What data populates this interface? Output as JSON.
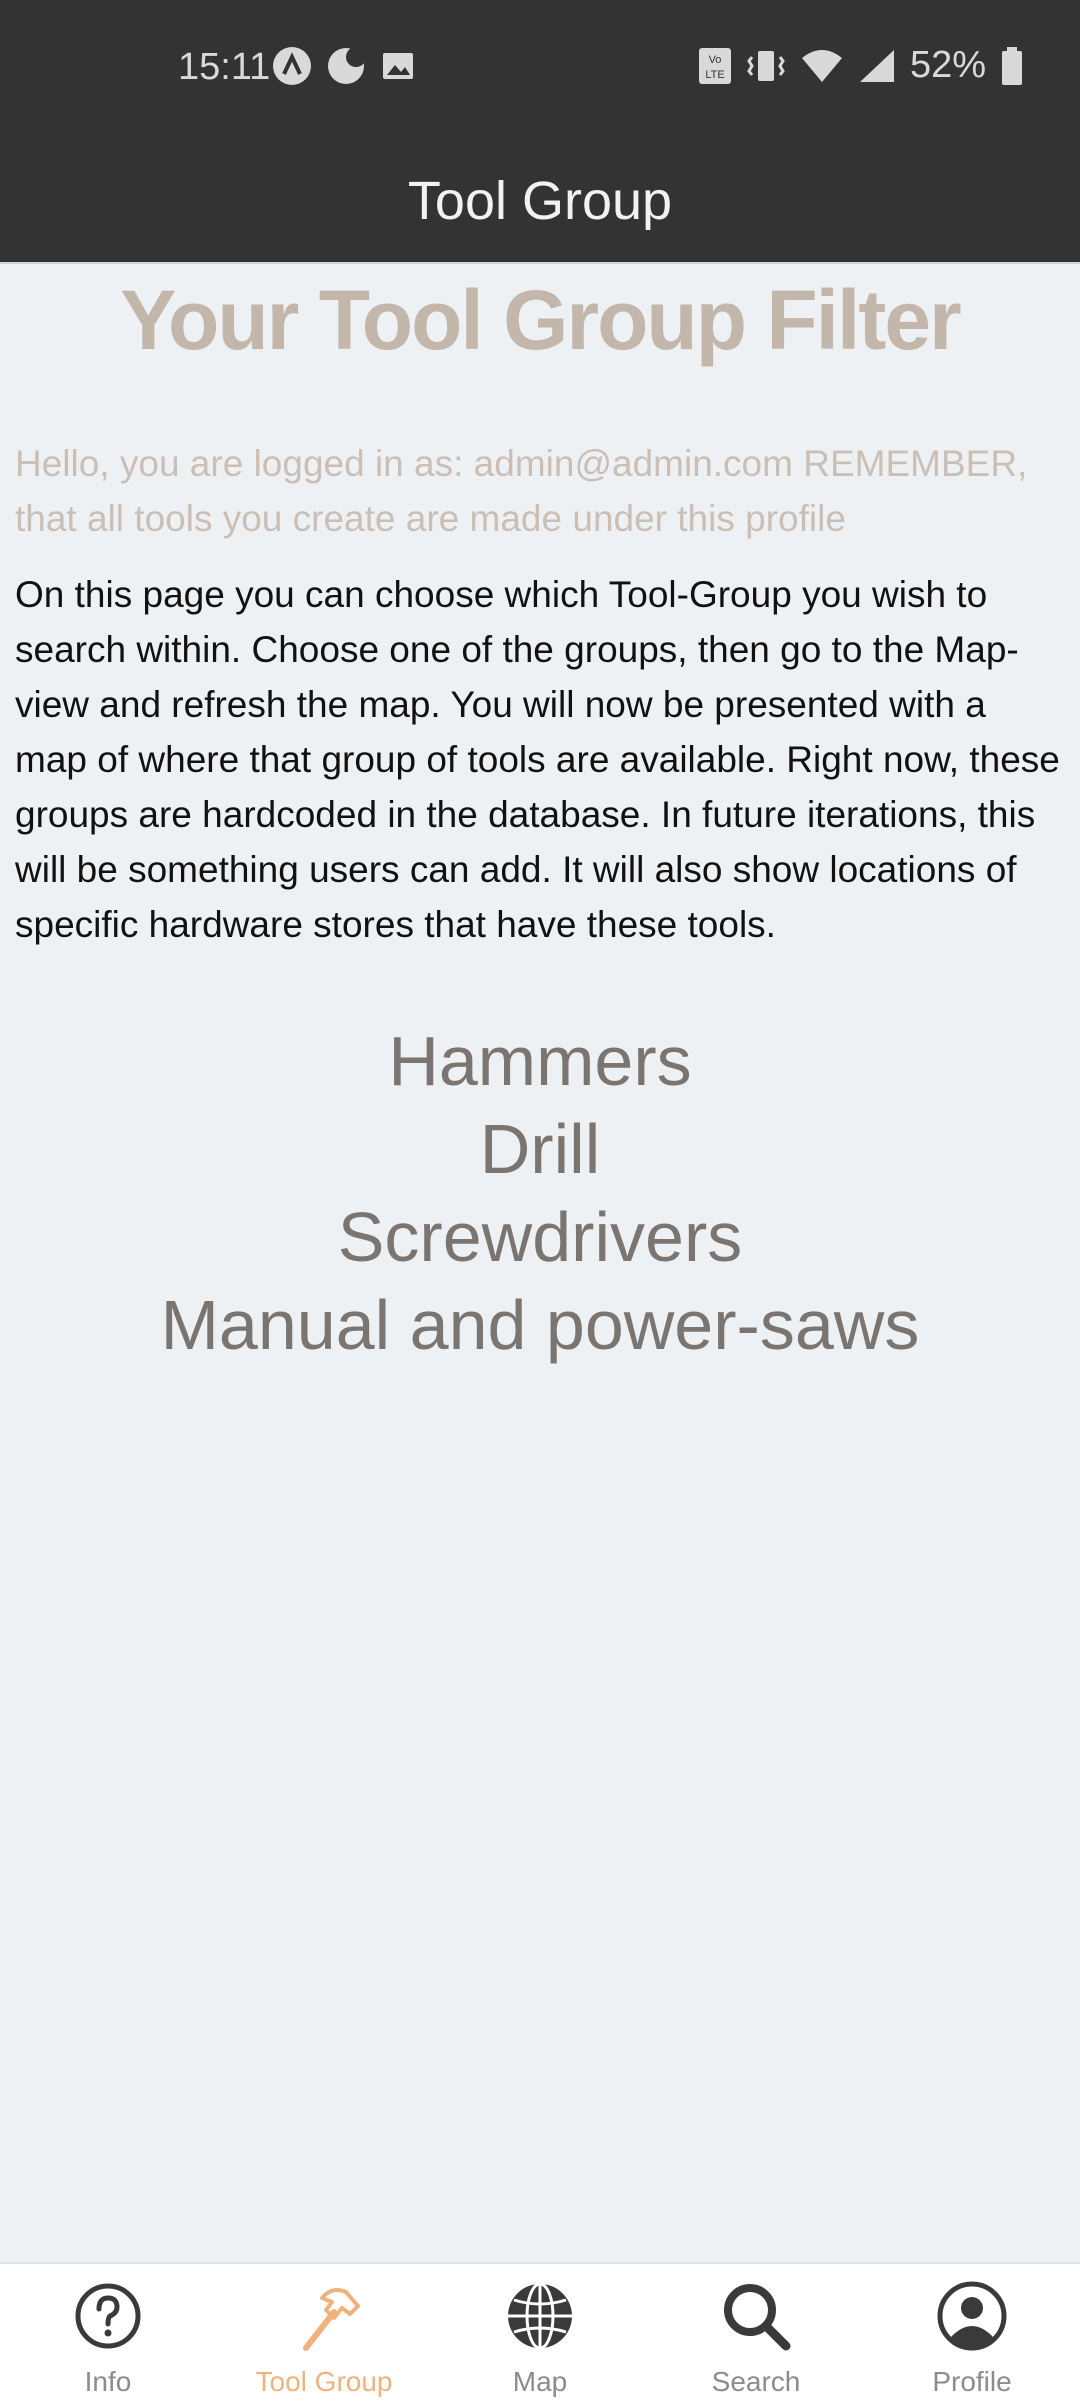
{
  "status_bar": {
    "time": "15:11",
    "battery": "52%",
    "icons": [
      "android-icon",
      "moon-icon",
      "image-icon",
      "volte-icon",
      "vibrate-icon",
      "wifi-icon",
      "signal-icon",
      "battery-icon"
    ]
  },
  "header": {
    "title": "Tool Group"
  },
  "main": {
    "title": "Your Tool Group Filter",
    "hello": "Hello, you are logged in as: admin@admin.com REMEMBER, that all tools you create are made under this profile",
    "description": "On this page you can choose which Tool-Group you wish to search within. Choose one of the groups, then go to the Map-view and refresh the map. You will now be presented with a map of where that group of tools are available. Right now, these groups are hardcoded in the database. In future iterations, this will be something users can add. It will also show locations of specific hardware stores that have these tools.",
    "groups": [
      "Hammers",
      "Drill",
      "Screwdrivers",
      "Manual and power-saws"
    ]
  },
  "tabs": [
    {
      "label": "Info",
      "icon": "question-circle-icon",
      "active": false
    },
    {
      "label": "Tool Group",
      "icon": "hammer-icon",
      "active": true
    },
    {
      "label": "Map",
      "icon": "globe-icon",
      "active": false
    },
    {
      "label": "Search",
      "icon": "search-icon",
      "active": false
    },
    {
      "label": "Profile",
      "icon": "profile-icon",
      "active": false
    }
  ],
  "colors": {
    "header_bg": "#333333",
    "accent": "#f0b27c",
    "title": "#c3b6ab",
    "group_text": "#7a7571",
    "background": "#eef1f4"
  }
}
